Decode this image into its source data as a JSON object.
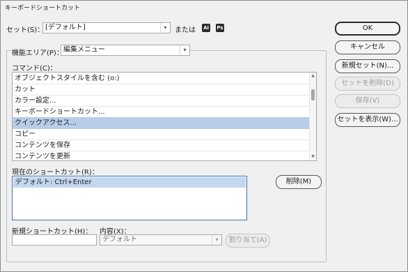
{
  "window": {
    "title": "キーボードショートカット"
  },
  "set": {
    "label": "セット(S)：",
    "value": "[デフォルト]",
    "or_label": "または",
    "ai_badge": "Ai",
    "ps_badge": "Ps"
  },
  "functional_area": {
    "label": "機能エリア(P)：",
    "value": "編集メニュー"
  },
  "commands": {
    "label": "コマンド(C)：",
    "items": [
      {
        "label": "オブジェクトスタイルを含む (o:)",
        "selected": false
      },
      {
        "label": "カット",
        "selected": false
      },
      {
        "label": "カラー設定...",
        "selected": false
      },
      {
        "label": "キーボードショートカット...",
        "selected": false
      },
      {
        "label": "クイックアクセス...",
        "selected": true
      },
      {
        "label": "コピー",
        "selected": false
      },
      {
        "label": "コンテンツを保存",
        "selected": false
      },
      {
        "label": "コンテンツを更新",
        "selected": false
      }
    ]
  },
  "current_shortcuts": {
    "label": "現在のショートカット(R)：",
    "items": [
      {
        "label": "デフォルト: Ctrl+Enter"
      }
    ],
    "remove_button": "削除(M)"
  },
  "new_shortcut": {
    "label": "新規ショートカット(H)：",
    "value": "",
    "context_label": "内容(X)：",
    "context_value": "デフォルト",
    "assign_button": "割り当て(A)"
  },
  "buttons": {
    "ok": "OK",
    "cancel": "キャンセル",
    "new_set": "新規セット(N)...",
    "delete_set": "セットを削除(D)",
    "save": "保存(V)",
    "show_set": "セットを表示(W)..."
  }
}
